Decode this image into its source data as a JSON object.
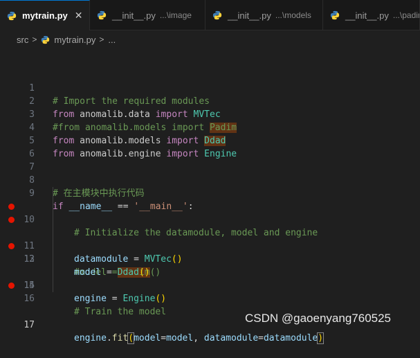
{
  "tabs": [
    {
      "label": "mytrain.py",
      "desc": "",
      "close": "✕"
    },
    {
      "label": "__init__.py",
      "desc": "...\\image"
    },
    {
      "label": "__init__.py",
      "desc": "...\\models"
    },
    {
      "label": "__init__.py",
      "desc": "...\\padim"
    }
  ],
  "breadcrumb": {
    "folder": "src",
    "file": "mytrain.py",
    "sep": ">",
    "more": "..."
  },
  "lines": {
    "n1": "1",
    "n2": "2",
    "n3": "3",
    "n4": "4",
    "n5": "5",
    "n6": "6",
    "n7": "7",
    "n8": "8",
    "n9": "9",
    "n10": "10",
    "n11": "11",
    "n12": "12",
    "n13": "13",
    "n14": "14",
    "n15": "15",
    "n16": "16",
    "n17": "17"
  },
  "code": {
    "l1": "# Import the required modules",
    "l2_kw1": "from",
    "l2_mod": "anomalib.data",
    "l2_kw2": "import",
    "l2_cls": "MVTec",
    "l3": "#from anomalib.models import ",
    "l3_hl": "Padim",
    "l4_kw1": "from",
    "l4_mod": "anomalib.models",
    "l4_kw2": "import",
    "l4_cls": "Ddad",
    "l5_kw1": "from",
    "l5_mod": "anomalib.engine",
    "l5_kw2": "import",
    "l5_cls": "Engine",
    "l8": "# 在主模块中执行代码",
    "l9_kw": "if",
    "l9_var": "__name__",
    "l9_op": " == ",
    "l9_str": "'__main__'",
    "l9_colon": ":",
    "l10": "# Initialize the datamodule, model and engine",
    "l11_var": "datamodule",
    "l11_op": " = ",
    "l11_cls": "MVTec",
    "l11_par": "()",
    "l12": "#model = ",
    "l12_hl": "Padim",
    "l12_tail": "()",
    "l13_var": "model",
    "l13_op": " = ",
    "l13_cls": "Ddad",
    "l13_par": "()",
    "l14_var": "engine",
    "l14_op": " = ",
    "l14_cls": "Engine",
    "l14_par": "()",
    "l16": "# Train the model",
    "l17_var": "engine",
    "l17_dot": ".",
    "l17_fn": "fit",
    "l17_po": "(",
    "l17_a1": "model",
    "l17_eq1": "=",
    "l17_v1": "model",
    "l17_comma": ", ",
    "l17_a2": "datamodule",
    "l17_eq2": "=",
    "l17_v2": "datamodule",
    "l17_pc": ")"
  },
  "watermark": "CSDN @gaoenyang760525",
  "colors": {
    "accent": "#0078d4",
    "breakpoint": "#e51400",
    "keyword": "#c586c0",
    "class": "#4ec9b0",
    "comment": "#6a9955",
    "string": "#ce9178",
    "variable": "#9cdcfe",
    "function": "#dcdcaa",
    "bracket": "#ffd700"
  },
  "icons": {
    "file": "python-file-icon",
    "close": "close-icon",
    "breakpoint": "breakpoint-icon"
  }
}
